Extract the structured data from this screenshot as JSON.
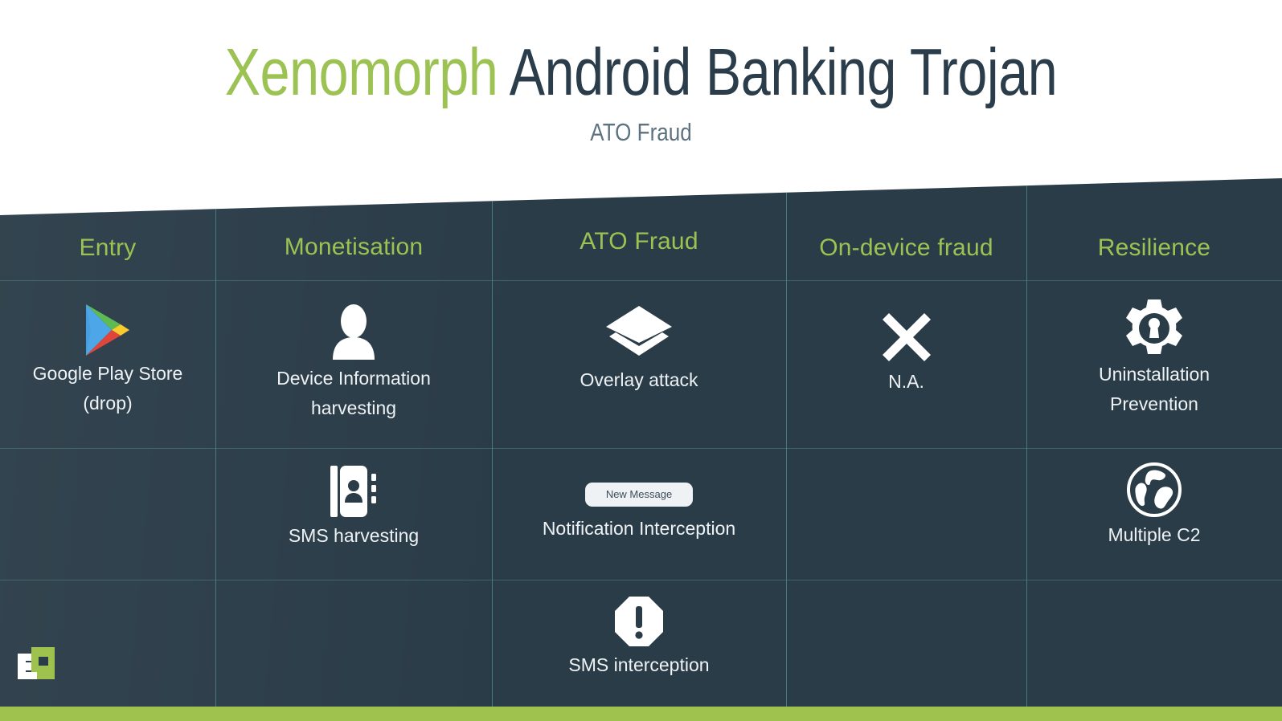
{
  "header": {
    "title_highlight": "Xenomorph",
    "title_rest": " Android Banking Trojan",
    "subtitle": "ATO Fraud"
  },
  "colors": {
    "accent_green": "#9BC252",
    "panel_dark": "#2A3C48",
    "grid_line": "#4C867E",
    "footer_bar": "#9FC24E",
    "text_light": "#EEF2F4",
    "pill_bg": "#EFF2F5",
    "pill_text": "#3E4E5A"
  },
  "columns": [
    {
      "id": "entry",
      "label": "Entry"
    },
    {
      "id": "monetisation",
      "label": "Monetisation"
    },
    {
      "id": "ato-fraud",
      "label": "ATO Fraud"
    },
    {
      "id": "on-device",
      "label": "On-device fraud"
    },
    {
      "id": "resilience",
      "label": "Resilience"
    }
  ],
  "cells": {
    "entry_1": {
      "label": "Google Play Store\n(drop)",
      "icon": "google-play-icon"
    },
    "monetisation_1": {
      "label": "Device Information\nharvesting",
      "icon": "person-silhouette-icon"
    },
    "monetisation_2": {
      "label": "SMS harvesting",
      "icon": "contacts-book-icon"
    },
    "ato_1": {
      "label": "Overlay attack",
      "icon": "layers-icon"
    },
    "ato_2": {
      "label": "Notification Interception",
      "icon": "notification-pill",
      "pill_text": "New Message"
    },
    "ato_3": {
      "label": "SMS interception",
      "icon": "octagon-exclamation-icon"
    },
    "ondevice_1": {
      "label": "N.A.",
      "icon": "x-cross-icon"
    },
    "resilience_1": {
      "label": "Uninstallation\nPrevention",
      "icon": "gear-keyhole-icon"
    },
    "resilience_2": {
      "label": "Multiple C2",
      "icon": "globe-icon"
    }
  },
  "footer": {
    "logo_name": "company-logo"
  }
}
